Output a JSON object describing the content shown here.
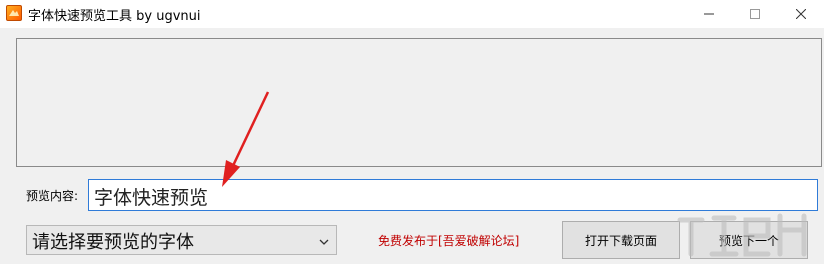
{
  "window": {
    "title": "字体快速预览工具 by ugvnui",
    "app_icon": "app-logo-icon",
    "controls": {
      "minimize": "—",
      "maximize": "☐",
      "close": "✕"
    }
  },
  "form": {
    "content_label": "预览内容:",
    "content_value": "字体快速预览",
    "font_select_value": "请选择要预览的字体",
    "release_note": "免费发布于[吾爱破解论坛]",
    "download_button": "打开下载页面",
    "next_button": "预览下一个"
  },
  "colors": {
    "accent_border": "#2f7bd8",
    "release_text": "#c00000",
    "annotation_arrow": "#e02020"
  },
  "overlay": {
    "annotation": "arrow pointing to content input",
    "watermark": "xiazaiba watermark"
  }
}
